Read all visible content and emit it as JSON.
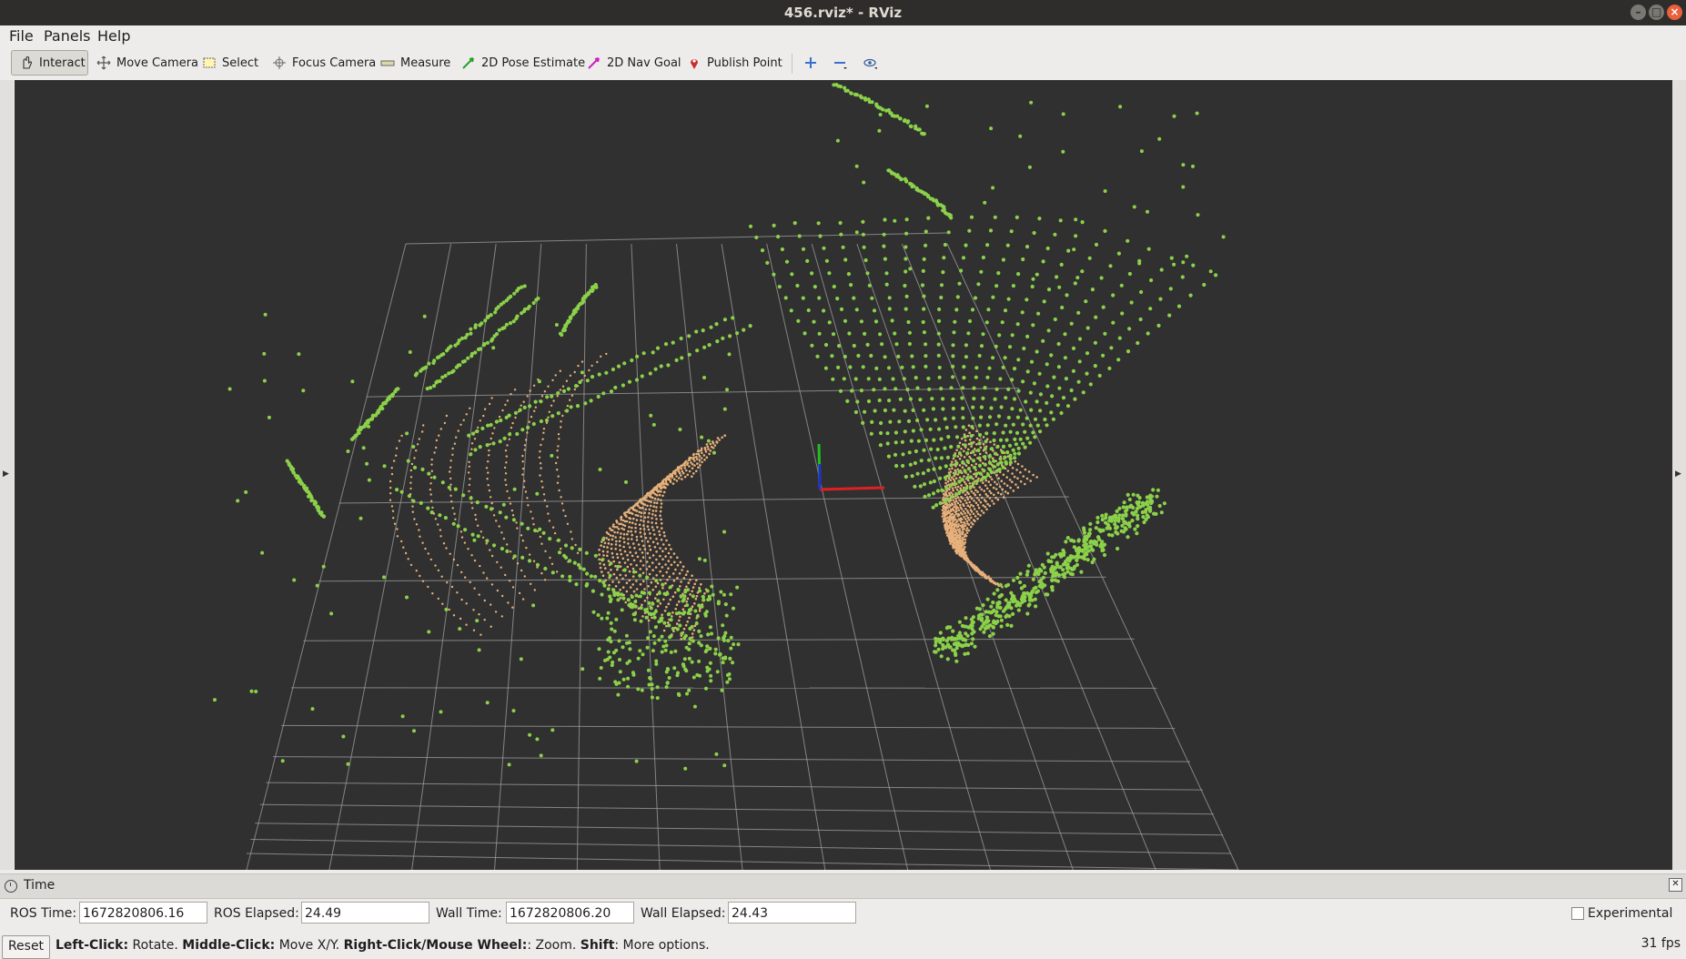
{
  "window": {
    "title": "456.rviz* - RViz"
  },
  "menu": [
    "File",
    "Panels",
    "Help"
  ],
  "toolbar": {
    "interact": "Interact",
    "move_camera": "Move Camera",
    "select": "Select",
    "focus_camera": "Focus Camera",
    "measure": "Measure",
    "pose_estimate": "2D Pose Estimate",
    "nav_goal": "2D Nav Goal",
    "publish_point": "Publish Point"
  },
  "time_panel": {
    "title": "Time",
    "ros_time_label": "ROS Time:",
    "ros_time": "1672820806.16",
    "ros_elapsed_label": "ROS Elapsed:",
    "ros_elapsed": "24.49",
    "wall_time_label": "Wall Time:",
    "wall_time": "1672820806.20",
    "wall_elapsed_label": "Wall Elapsed:",
    "wall_elapsed": "24.43",
    "experimental": "Experimental"
  },
  "status": {
    "reset": "Reset",
    "left_click": "Left-Click:",
    "left_action": " Rotate. ",
    "middle_click": "Middle-Click:",
    "middle_action": " Move X/Y. ",
    "right_click": "Right-Click/Mouse Wheel:",
    "right_action": ": Zoom. ",
    "shift": "Shift",
    "shift_action": ": More options.",
    "fps": "31 fps"
  },
  "colors": {
    "background": "#303030",
    "grid": "#a0a0a0",
    "green_points": "#8bd14a",
    "orange_points": "#e8b07a",
    "axis_x": "#e02020",
    "axis_y": "#20c020",
    "axis_z": "#2030d0"
  }
}
